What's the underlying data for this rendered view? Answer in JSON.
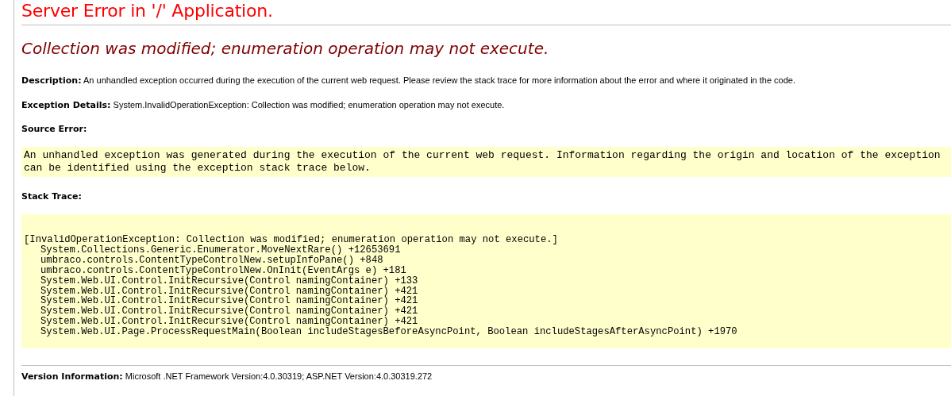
{
  "title": "Server Error in '/' Application.",
  "error_message": "Collection was modified; enumeration operation may not execute.",
  "description": {
    "label": "Description:",
    "text": "An unhandled exception occurred during the execution of the current web request. Please review the stack trace for more information about the error and where it originated in the code."
  },
  "exception_details": {
    "label": "Exception Details:",
    "text": "System.InvalidOperationException: Collection was modified; enumeration operation may not execute."
  },
  "source_error": {
    "label": "Source Error:",
    "text": "An unhandled exception was generated during the execution of the current web request. Information regarding the origin and location of the exception can be identified using the exception stack trace below."
  },
  "stack_trace": {
    "label": "Stack Trace:",
    "exception": "[InvalidOperationException: Collection was modified; enumeration operation may not execute.]",
    "frames": [
      "System.Collections.Generic.Enumerator.MoveNextRare() +12653691",
      "umbraco.controls.ContentTypeControlNew.setupInfoPane() +848",
      "umbraco.controls.ContentTypeControlNew.OnInit(EventArgs e) +181",
      "System.Web.UI.Control.InitRecursive(Control namingContainer) +133",
      "System.Web.UI.Control.InitRecursive(Control namingContainer) +421",
      "System.Web.UI.Control.InitRecursive(Control namingContainer) +421",
      "System.Web.UI.Control.InitRecursive(Control namingContainer) +421",
      "System.Web.UI.Control.InitRecursive(Control namingContainer) +421",
      "System.Web.UI.Page.ProcessRequestMain(Boolean includeStagesBeforeAsyncPoint, Boolean includeStagesAfterAsyncPoint) +1970"
    ]
  },
  "version_information": {
    "label": "Version Information:",
    "text": "Microsoft .NET Framework Version:4.0.30319; ASP.NET Version:4.0.30319.272"
  }
}
